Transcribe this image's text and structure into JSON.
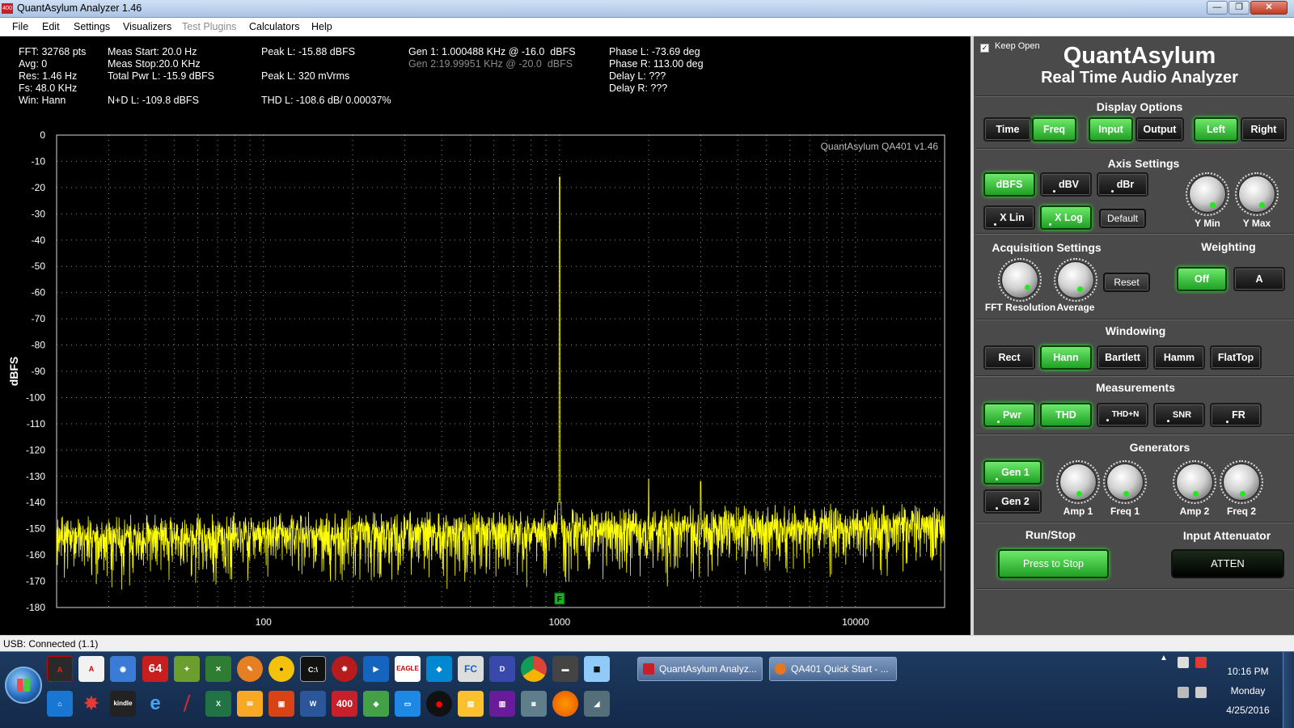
{
  "window": {
    "title": "QuantAsylum Analyzer 1.46",
    "icon_text": "400",
    "min_glyph": "—",
    "max_glyph": "❐",
    "close_glyph": "✕"
  },
  "menu": [
    "File",
    "Edit",
    "Settings",
    "Visualizers",
    "Test Plugins",
    "Calculators",
    "Help"
  ],
  "readouts": {
    "fft": "FFT: 32768 pts",
    "avg": "Avg: 0",
    "res": "Res: 1.46 Hz",
    "fs": "Fs: 48.0 KHz",
    "win": "Win: Hann",
    "meas_start": "Meas Start: 20.0 Hz",
    "meas_stop": "Meas Stop:20.0 KHz",
    "total_pwr": "Total Pwr L: -15.9 dBFS",
    "nd": "N+D L: -109.8 dBFS",
    "peak_dbfs": "Peak L: -15.88 dBFS",
    "peak_mvrms": "Peak L: 320 mVrms",
    "thd": "THD L: -108.6 dB/ 0.00037%",
    "gen1": "Gen 1: 1.000488 KHz @ -16.0  dBFS",
    "gen2": "Gen 2:19.99951 KHz @ -20.0  dBFS",
    "phase_l": "Phase L: -73.69 deg",
    "phase_r": "Phase R: 113.00 deg",
    "delay_l": "Delay L: ???",
    "delay_r": "Delay R: ???"
  },
  "chart_data": {
    "type": "line",
    "ylabel": "dBFS",
    "watermark": "QuantAsylum QA401 v1.46",
    "x_scale": "log",
    "xlim": [
      20,
      20000
    ],
    "ylim": [
      -180,
      0
    ],
    "y_ticks": [
      0,
      -10,
      -20,
      -30,
      -40,
      -50,
      -60,
      -70,
      -80,
      -90,
      -100,
      -110,
      -120,
      -130,
      -140,
      -150,
      -160,
      -170,
      -180
    ],
    "x_ticks": [
      100,
      1000,
      10000
    ],
    "x_tick_labels": [
      "100",
      "1000",
      "10000"
    ],
    "grid": true,
    "line_color": "#ffff00",
    "marker_label": "F",
    "series": [
      {
        "values_description": "noise floor",
        "fundamental": {
          "x": 1000,
          "y": -16
        },
        "harmonics": [
          {
            "x": 2000,
            "y": -131
          },
          {
            "x": 3000,
            "y": -132
          }
        ],
        "noise_floor_low": -150,
        "noise_floor_high": -145
      }
    ]
  },
  "panel": {
    "keep_open": "Keep Open",
    "brand": "QuantAsylum",
    "subtitle": "Real Time Audio Analyzer",
    "display_options": {
      "title": "Display Options",
      "buttons": [
        {
          "label": "Time",
          "on": false
        },
        {
          "label": "Freq",
          "on": true
        },
        {
          "label": "Input",
          "on": true
        },
        {
          "label": "Output",
          "on": false
        },
        {
          "label": "Left",
          "on": true
        },
        {
          "label": "Right",
          "on": false
        }
      ]
    },
    "axis_settings": {
      "title": "Axis Settings",
      "buttons": [
        {
          "label": "dBFS",
          "on": true
        },
        {
          "label": "dBV",
          "on": false
        },
        {
          "label": "dBr",
          "on": false
        },
        {
          "label": "X Lin",
          "on": false
        },
        {
          "label": "X Log",
          "on": true
        }
      ],
      "default_label": "Default",
      "knobs": [
        "Y Min",
        "Y Max"
      ]
    },
    "acquisition": {
      "title": "Acquisition Settings",
      "knobs": [
        "FFT Resolution",
        "Average"
      ],
      "reset_label": "Reset"
    },
    "weighting": {
      "title": "Weighting",
      "buttons": [
        {
          "label": "Off",
          "on": true
        },
        {
          "label": "A",
          "on": false
        }
      ]
    },
    "windowing": {
      "title": "Windowing",
      "buttons": [
        {
          "label": "Rect",
          "on": false
        },
        {
          "label": "Hann",
          "on": true
        },
        {
          "label": "Bartlett",
          "on": false
        },
        {
          "label": "Hamm",
          "on": false
        },
        {
          "label": "FlatTop",
          "on": false
        }
      ]
    },
    "measurements": {
      "title": "Measurements",
      "buttons": [
        {
          "label": "Pwr",
          "on": true
        },
        {
          "label": "THD",
          "on": true
        },
        {
          "label": "THD+N",
          "on": false
        },
        {
          "label": "SNR",
          "on": false
        },
        {
          "label": "FR",
          "on": false
        }
      ]
    },
    "generators": {
      "title": "Generators",
      "buttons": [
        {
          "label": "Gen 1",
          "on": true
        },
        {
          "label": "Gen 2",
          "on": false
        }
      ],
      "knobs": [
        "Amp 1",
        "Freq 1",
        "Amp 2",
        "Freq 2"
      ]
    },
    "runstop": {
      "title": "Run/Stop",
      "button": "Press to Stop"
    },
    "attenuator": {
      "title": "Input Attenuator",
      "button": "ATTEN"
    }
  },
  "status": "USB: Connected  (1.1)",
  "taskbar": {
    "pinned_row1": [
      "64",
      "400"
    ],
    "buttons": [
      {
        "label": "QuantAsylum Analyz...",
        "color": "#c8202a"
      },
      {
        "label": "QA401 Quick Start - ...",
        "color": "#e8761a"
      }
    ],
    "clock": {
      "time": "10:16 PM",
      "day": "Monday",
      "date": "4/25/2016"
    }
  }
}
